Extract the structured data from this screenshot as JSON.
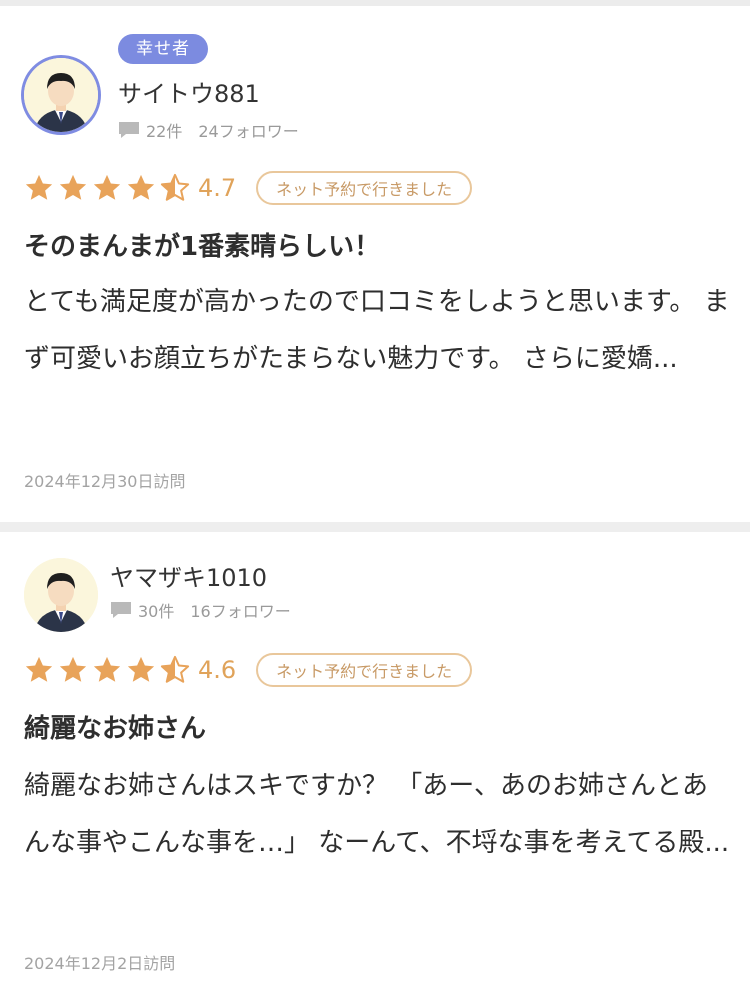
{
  "reviews": [
    {
      "badge": "幸せ者",
      "username": "サイトウ881",
      "post_count": "22件",
      "followers": "24フォロワー",
      "rating": 4.7,
      "rating_label": "4.7",
      "tag": "ネット予約で行きました",
      "title": "そのまんまが1番素晴らしい！",
      "body": "とても満足度が高かったので口コミをしようと思います。 まず可愛いお顔立ちがたまらない魅力です。 さらに愛嬌...",
      "visit_date": "2024年12月30日訪問"
    },
    {
      "username": "ヤマザキ1010",
      "post_count": "30件",
      "followers": "16フォロワー",
      "rating": 4.6,
      "rating_label": "4.6",
      "tag": "ネット予約で行きました",
      "title": "綺麗なお姉さん",
      "body": "綺麗なお姉さんはスキですか？ 「あー、あのお姉さんとあんな事やこんな事を…」 なーんて、不埒な事を考えてる殿...",
      "visit_date": "2024年12月2日訪問"
    }
  ],
  "colors": {
    "badge": "#7c8be0",
    "star": "#e8a35a",
    "tag_border": "#e9c79b",
    "tag_text": "#c89a66"
  }
}
